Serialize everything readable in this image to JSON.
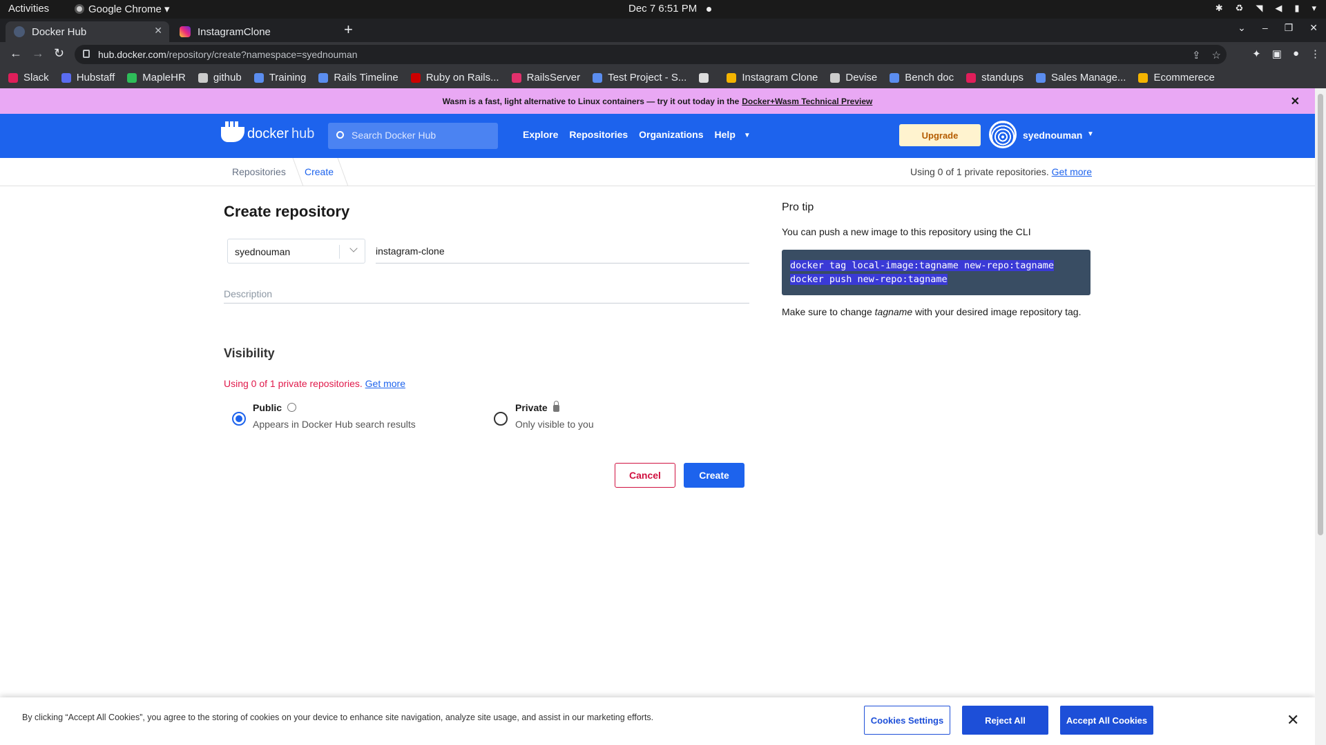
{
  "os_bar": {
    "activities": "Activities",
    "app_name": "Google Chrome ▾",
    "clock": "Dec 7  6:51 PM"
  },
  "browser": {
    "tabs": [
      {
        "label": "Docker Hub",
        "active": true
      },
      {
        "label": "InstagramClone",
        "active": false
      }
    ],
    "new_tab": "+",
    "url_host": "hub.docker.com",
    "url_path": "/repository/create?namespace=syednouman",
    "bookmarks": [
      {
        "label": "Slack",
        "color": "#e01e5a"
      },
      {
        "label": "Hubstaff",
        "color": "#5a6cf0"
      },
      {
        "label": "MapleHR",
        "color": "#2ebd59"
      },
      {
        "label": "github",
        "color": "#cccccc"
      },
      {
        "label": "Training",
        "color": "#5b8def"
      },
      {
        "label": "Rails Timeline",
        "color": "#5b8def"
      },
      {
        "label": "Ruby on Rails...",
        "color": "#cc0000"
      },
      {
        "label": "RailsServer",
        "color": "#e1306c"
      },
      {
        "label": "Test Project - S...",
        "color": "#5b8def"
      },
      {
        "label": "",
        "color": "#dddddd"
      },
      {
        "label": "Instagram Clone",
        "color": "#f4b400"
      },
      {
        "label": "Devise",
        "color": "#cccccc"
      },
      {
        "label": "Bench doc",
        "color": "#5b8def"
      },
      {
        "label": "standups",
        "color": "#e01e5a"
      },
      {
        "label": "Sales Manage...",
        "color": "#5b8def"
      },
      {
        "label": "Ecommerece",
        "color": "#f4b400"
      }
    ]
  },
  "promo": {
    "text": "Wasm is a fast, light alternative to Linux containers — try it out today in the",
    "link": "Docker+Wasm Technical Preview"
  },
  "hub_nav": {
    "logo_bold": "docker",
    "logo_light": "hub",
    "search_placeholder": "Search Docker Hub",
    "links": [
      "Explore",
      "Repositories",
      "Organizations",
      "Help"
    ],
    "upgrade": "Upgrade",
    "username": "syednouman"
  },
  "breadcrumb": {
    "repositories": "Repositories",
    "create": "Create"
  },
  "usage": {
    "text": "Using 0 of 1 private repositories.",
    "link": "Get more"
  },
  "form": {
    "title": "Create repository",
    "namespace": "syednouman",
    "repo_name": "instagram-clone",
    "description_placeholder": "Description",
    "visibility_title": "Visibility",
    "options": [
      {
        "title": "Public",
        "subtitle": "Appears in Docker Hub search results",
        "selected": true
      },
      {
        "title": "Private",
        "subtitle": "Only visible to you",
        "selected": false
      }
    ],
    "cancel": "Cancel",
    "create": "Create"
  },
  "pro_tip": {
    "title": "Pro tip",
    "text": "You can push a new image to this repository using the CLI",
    "code_line1": "docker tag local-image:tagname new-repo:tagname",
    "code_line2": "docker push new-repo:tagname",
    "note_before": "Make sure to change ",
    "note_em": "tagname",
    "note_after": " with your desired image repository tag."
  },
  "cookie": {
    "text": "By clicking “Accept All Cookies”, you agree to the storing of cookies on your device to enhance site navigation, analyze site usage, and assist in our marketing efforts.",
    "settings": "Cookies Settings",
    "reject": "Reject All",
    "accept": "Accept All Cookies"
  },
  "colors": {
    "docker_blue": "#1d63ed",
    "promo_bg": "#e9a8f4",
    "error_red": "#e0194a"
  }
}
